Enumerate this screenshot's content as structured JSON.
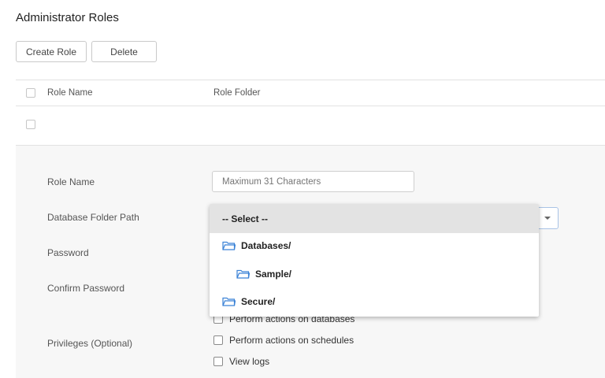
{
  "page_title": "Administrator Roles",
  "toolbar": {
    "create_label": "Create Role",
    "delete_label": "Delete"
  },
  "table": {
    "columns": [
      "Role Name",
      "Role Folder"
    ]
  },
  "form": {
    "role_name_label": "Role Name",
    "role_name_placeholder": "Maximum 31 Characters",
    "folder_path_label": "Database Folder Path",
    "password_label": "Password",
    "confirm_password_label": "Confirm Password",
    "privileges_label": "Privileges (Optional)"
  },
  "dropdown": {
    "selected": "-- Select --",
    "options": [
      "Databases/",
      "Sample/",
      "Secure/"
    ],
    "folder_icon": "folder-icon",
    "folder_color": "#3b82d6"
  },
  "privileges": [
    "Perform actions on databases",
    "Perform actions on schedules",
    "View logs"
  ]
}
